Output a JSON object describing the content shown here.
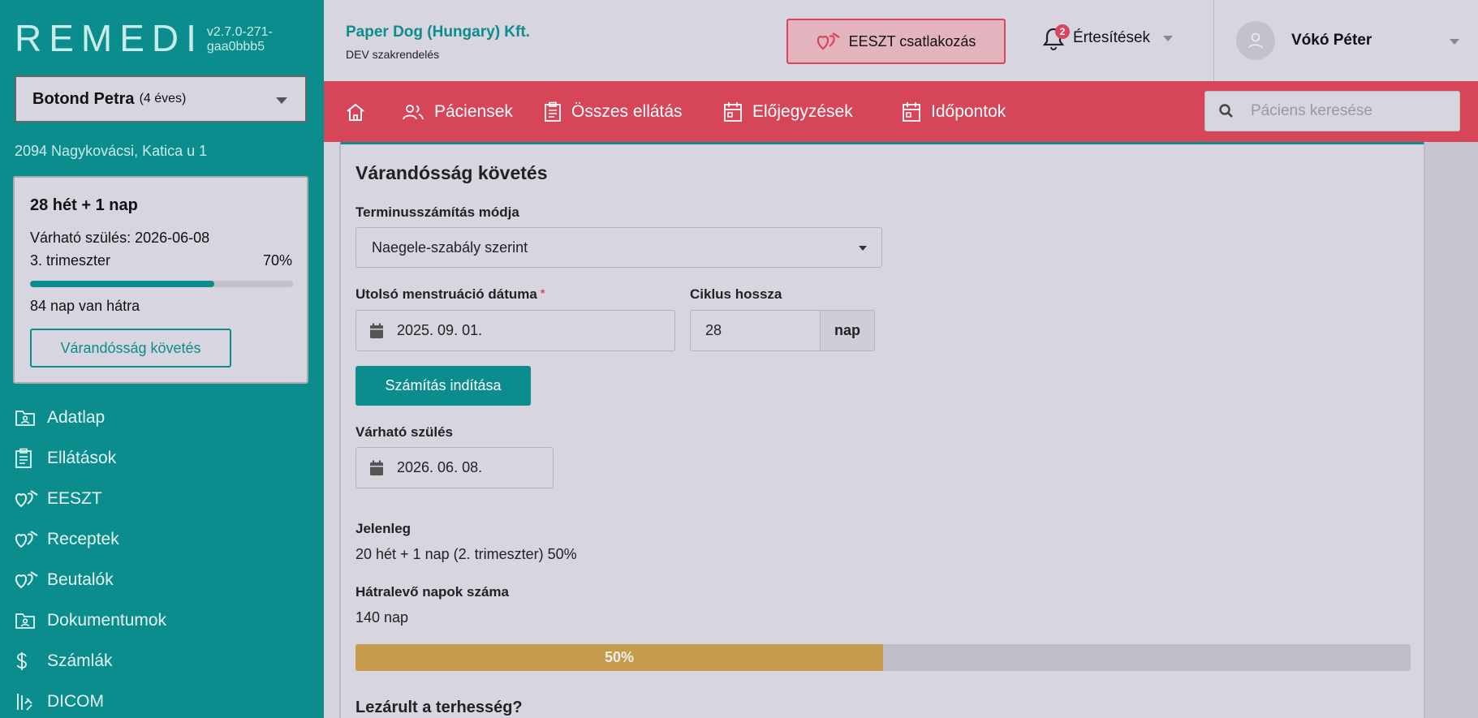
{
  "app": {
    "logo": "REMEDI",
    "version": "v2.7.0-271-gaa0bbb5"
  },
  "patient": {
    "name": "Botond Petra",
    "age": "(4 éves)",
    "address": "2094 Nagykovácsi, Katica u 1"
  },
  "pregnancy_card": {
    "weeks": "28 hét + 1 nap",
    "due_date": "Várható szülés: 2026-06-08",
    "trimester": "3. trimeszter",
    "percent_label": "70%",
    "progress_fraction": 0.7,
    "days_left": "84 nap van hátra",
    "button_label": "Várandósság követés"
  },
  "sidebar": {
    "items": [
      {
        "label": "Adatlap",
        "icon": "folder-user-icon"
      },
      {
        "label": "Ellátások",
        "icon": "clipboard-icon"
      },
      {
        "label": "EESZT",
        "icon": "eeszt-heart-icon"
      },
      {
        "label": "Receptek",
        "icon": "eeszt-heart-icon"
      },
      {
        "label": "Beutalók",
        "icon": "eeszt-heart-icon"
      },
      {
        "label": "Dokumentumok",
        "icon": "folder-user-icon"
      },
      {
        "label": "Számlák",
        "icon": "dollar-icon"
      },
      {
        "label": "DICOM",
        "icon": "dicom-icon"
      }
    ]
  },
  "header": {
    "org_name": "Paper Dog (Hungary) Kft.",
    "org_sub": "DEV szakrendelés",
    "eeszt_button": "EESZT csatlakozás",
    "notifications_label": "Értesítések",
    "notifications_count": "2",
    "user_name": "Vókó Péter"
  },
  "navbar": {
    "items": [
      {
        "label": "Páciensek"
      },
      {
        "label": "Összes ellátás"
      },
      {
        "label": "Előjegyzések"
      },
      {
        "label": "Időpontok"
      }
    ],
    "search_placeholder": "Páciens keresése"
  },
  "form": {
    "title": "Várandósság követés",
    "method_label": "Terminusszámítás módja",
    "method_value": "Naegele-szabály szerint",
    "lmp_label": "Utolsó menstruáció dátuma",
    "lmp_required": "*",
    "lmp_value": "2025. 09. 01.",
    "cycle_label": "Ciklus hossza",
    "cycle_value": "28",
    "cycle_unit": "nap",
    "calc_button": "Számítás indítása",
    "due_label": "Várható szülés",
    "due_value": "2026. 06. 08.",
    "current_label": "Jelenleg",
    "current_value": "20 hét + 1 nap (2. trimeszter) 50%",
    "remaining_label": "Hátralevő napok száma",
    "remaining_value": "140 nap",
    "progress_label": "50%",
    "progress_fraction": 0.5,
    "closed_question": "Lezárult a terhesség?"
  },
  "colors": {
    "teal": "#0a8d8c",
    "red": "#d64558",
    "gold": "#c69b4c"
  }
}
